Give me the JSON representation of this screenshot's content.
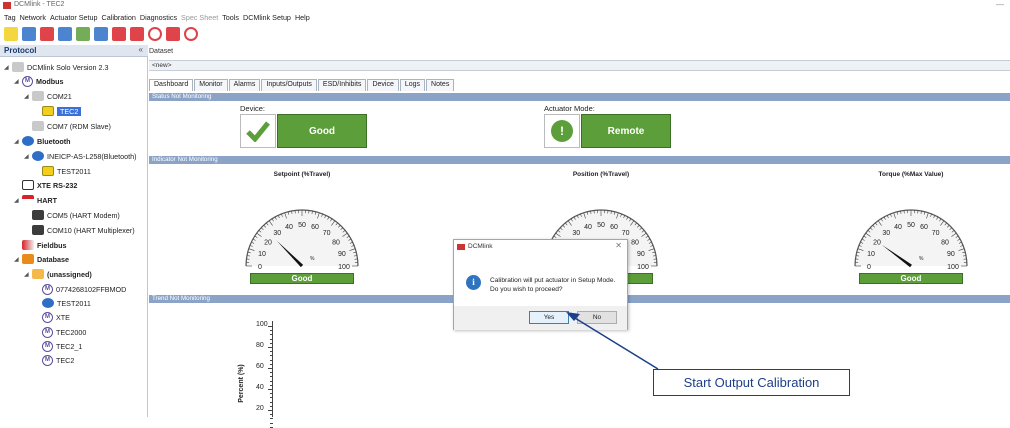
{
  "window": {
    "title": "DCMlink - TEC2",
    "minimize": "—"
  },
  "menu": [
    {
      "label": "Tag",
      "dim": false
    },
    {
      "label": "Network",
      "dim": false
    },
    {
      "label": "Actuator Setup",
      "dim": false
    },
    {
      "label": "Calibration",
      "dim": false
    },
    {
      "label": "Diagnostics",
      "dim": false
    },
    {
      "label": "Spec Sheet",
      "dim": true
    },
    {
      "label": "Tools",
      "dim": false
    },
    {
      "label": "DCMlink Setup",
      "dim": false
    },
    {
      "label": "Help",
      "dim": false
    }
  ],
  "toolbar_icons": [
    "add-tag-icon",
    "open-icon",
    "network-icon",
    "actuator-icon",
    "calibrate-icon",
    "diagnostics-icon",
    "spec-sheet-icon",
    "flag-icon",
    "search-icon",
    "run-icon",
    "stop-icon"
  ],
  "protocol": {
    "title": "Protocol",
    "pin": "«",
    "tree": [
      {
        "label": "DCMlink Solo Version 2.3",
        "indent": 0,
        "arrow": "◢",
        "icon": "plug",
        "bold": false
      },
      {
        "label": "Modbus",
        "indent": 1,
        "arrow": "◢",
        "icon": "m",
        "bold": true
      },
      {
        "label": "COM21",
        "indent": 2,
        "arrow": "◢",
        "icon": "plug",
        "bold": false
      },
      {
        "label": "TEC2",
        "indent": 3,
        "arrow": "",
        "icon": "yel",
        "bold": false,
        "selected": true
      },
      {
        "label": "COM7 (RDM Slave)",
        "indent": 2,
        "arrow": "",
        "icon": "plug",
        "bold": false
      },
      {
        "label": "Bluetooth",
        "indent": 1,
        "arrow": "◢",
        "icon": "bt",
        "bold": true
      },
      {
        "label": "INEICP-AS-L258(Bluetooth)",
        "indent": 2,
        "arrow": "◢",
        "icon": "bt",
        "bold": false
      },
      {
        "label": "TEST2011",
        "indent": 3,
        "arrow": "",
        "icon": "yel",
        "bold": false
      },
      {
        "label": "XTE RS-232",
        "indent": 1,
        "arrow": "",
        "icon": "box",
        "bold": true
      },
      {
        "label": "HART",
        "indent": 1,
        "arrow": "◢",
        "icon": "hart",
        "bold": true
      },
      {
        "label": "COM5 (HART Modem)",
        "indent": 2,
        "arrow": "",
        "icon": "dev",
        "bold": false
      },
      {
        "label": "COM10 (HART Multiplexer)",
        "indent": 2,
        "arrow": "",
        "icon": "dev",
        "bold": false
      },
      {
        "label": "Fieldbus",
        "indent": 1,
        "arrow": "",
        "icon": "field",
        "bold": true
      },
      {
        "label": "Database",
        "indent": 1,
        "arrow": "◢",
        "icon": "db",
        "bold": true
      },
      {
        "label": "(unassigned)",
        "indent": 2,
        "arrow": "◢",
        "icon": "folder",
        "bold": true
      },
      {
        "label": "0774268102FFBMOD",
        "indent": 3,
        "arrow": "",
        "icon": "m",
        "bold": false
      },
      {
        "label": "TEST2011",
        "indent": 3,
        "arrow": "",
        "icon": "bt",
        "bold": false
      },
      {
        "label": "XTE",
        "indent": 3,
        "arrow": "",
        "icon": "m",
        "bold": false
      },
      {
        "label": "TEC2000",
        "indent": 3,
        "arrow": "",
        "icon": "m",
        "bold": false
      },
      {
        "label": "TEC2_1",
        "indent": 3,
        "arrow": "",
        "icon": "m",
        "bold": false
      },
      {
        "label": "TEC2",
        "indent": 3,
        "arrow": "",
        "icon": "m",
        "bold": false
      }
    ]
  },
  "dataset": {
    "title": "Dataset",
    "value": "<new>"
  },
  "tabs": [
    "Dashboard",
    "Monitor",
    "Alarms",
    "Inputs/Outputs",
    "ESD/Inhibits",
    "Device",
    "Logs",
    "Notes"
  ],
  "status": {
    "header": "Status Not Monitoring",
    "device_label": "Device:",
    "device_value": "Good",
    "mode_label": "Actuator Mode:",
    "mode_value": "Remote"
  },
  "indicator": {
    "header": "Indicator Not Monitoring",
    "gauges": [
      {
        "title": "Setpoint (%Travel)",
        "status": "Good",
        "value": 25
      },
      {
        "title": "Position (%Travel)",
        "status": "",
        "value": 25
      },
      {
        "title": "Torque (%Max Value)",
        "status": "Good",
        "value": 20
      }
    ],
    "ticks": [
      "0",
      "10",
      "20",
      "30",
      "40",
      "50",
      "60",
      "70",
      "80",
      "90",
      "100"
    ],
    "unit": "%"
  },
  "trend": {
    "header": "Trend Not Monitoring",
    "ylabel": "Percent (%)",
    "yticks": [
      "100",
      "80",
      "60",
      "40",
      "20"
    ]
  },
  "dialog": {
    "title": "DCMlink",
    "close": "✕",
    "line1": "Calibration will put actuator in Setup Mode.",
    "line2": "Do you wish to proceed?",
    "yes": "Yes",
    "no": "No"
  },
  "callout": {
    "text": "Start Output Calibration"
  },
  "colors": {
    "accent": "#5c9e3a",
    "header": "#8aa3c7",
    "callout": "#1d3f8a",
    "selection": "#3a70d8"
  }
}
